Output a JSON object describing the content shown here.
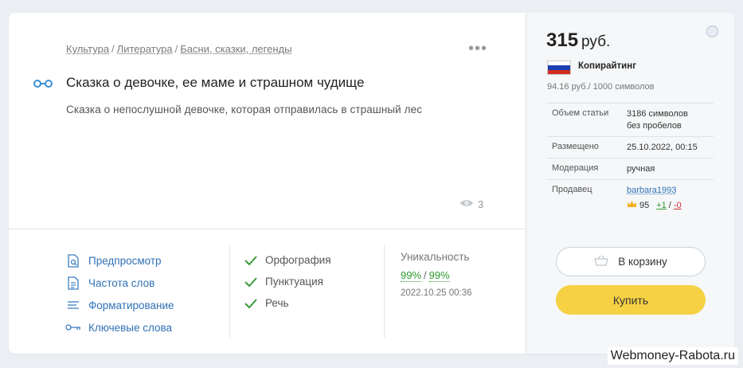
{
  "breadcrumb": [
    "Культура",
    "Литература",
    "Басни, сказки, легенды"
  ],
  "breadcrumb_sep": "/",
  "menu_dots": "•••",
  "article": {
    "title": "Сказка о девочке, ее маме и страшном чудище",
    "description": "Сказка о непослушной девочке, которая отправилась в страшный лес",
    "views": "3"
  },
  "tools": [
    {
      "label": "Предпросмотр",
      "icon": "document-search-icon"
    },
    {
      "label": "Частота слов",
      "icon": "document-icon"
    },
    {
      "label": "Форматирование",
      "icon": "text-lines-icon"
    },
    {
      "label": "Ключевые слова",
      "icon": "key-icon"
    }
  ],
  "checks": [
    "Орфография",
    "Пунктуация",
    "Речь"
  ],
  "uniqueness": {
    "label": "Уникальность",
    "value1": "99%",
    "sep": "/",
    "value2": "99%",
    "date": "2022.10.25 00:36"
  },
  "sidebar": {
    "price": "315",
    "currency": "руб.",
    "category": "Копирайтинг",
    "rate": "94.16 руб./ 1000 символов",
    "props": {
      "volume_label": "Объем статьи",
      "volume_value1": "3186 символов",
      "volume_value2": "без пробелов",
      "posted_label": "Размещено",
      "posted_value": "25.10.2022, 00:15",
      "moderation_label": "Модерация",
      "moderation_value": "ручная",
      "seller_label": "Продавец",
      "seller_name": "barbara1993",
      "seller_rating": "95",
      "plus": "+1",
      "minus": "-0",
      "rating_sep": "/"
    },
    "cart_label": "В корзину",
    "buy_label": "Купить"
  },
  "colors": {
    "accent_blue": "#3072b5",
    "green": "#2e9a2e",
    "buy_yellow": "#f6d143",
    "flag": [
      "#ffffff",
      "#1c3fb0",
      "#d52b1e"
    ]
  },
  "watermark": "Webmoney-Rabota.ru"
}
